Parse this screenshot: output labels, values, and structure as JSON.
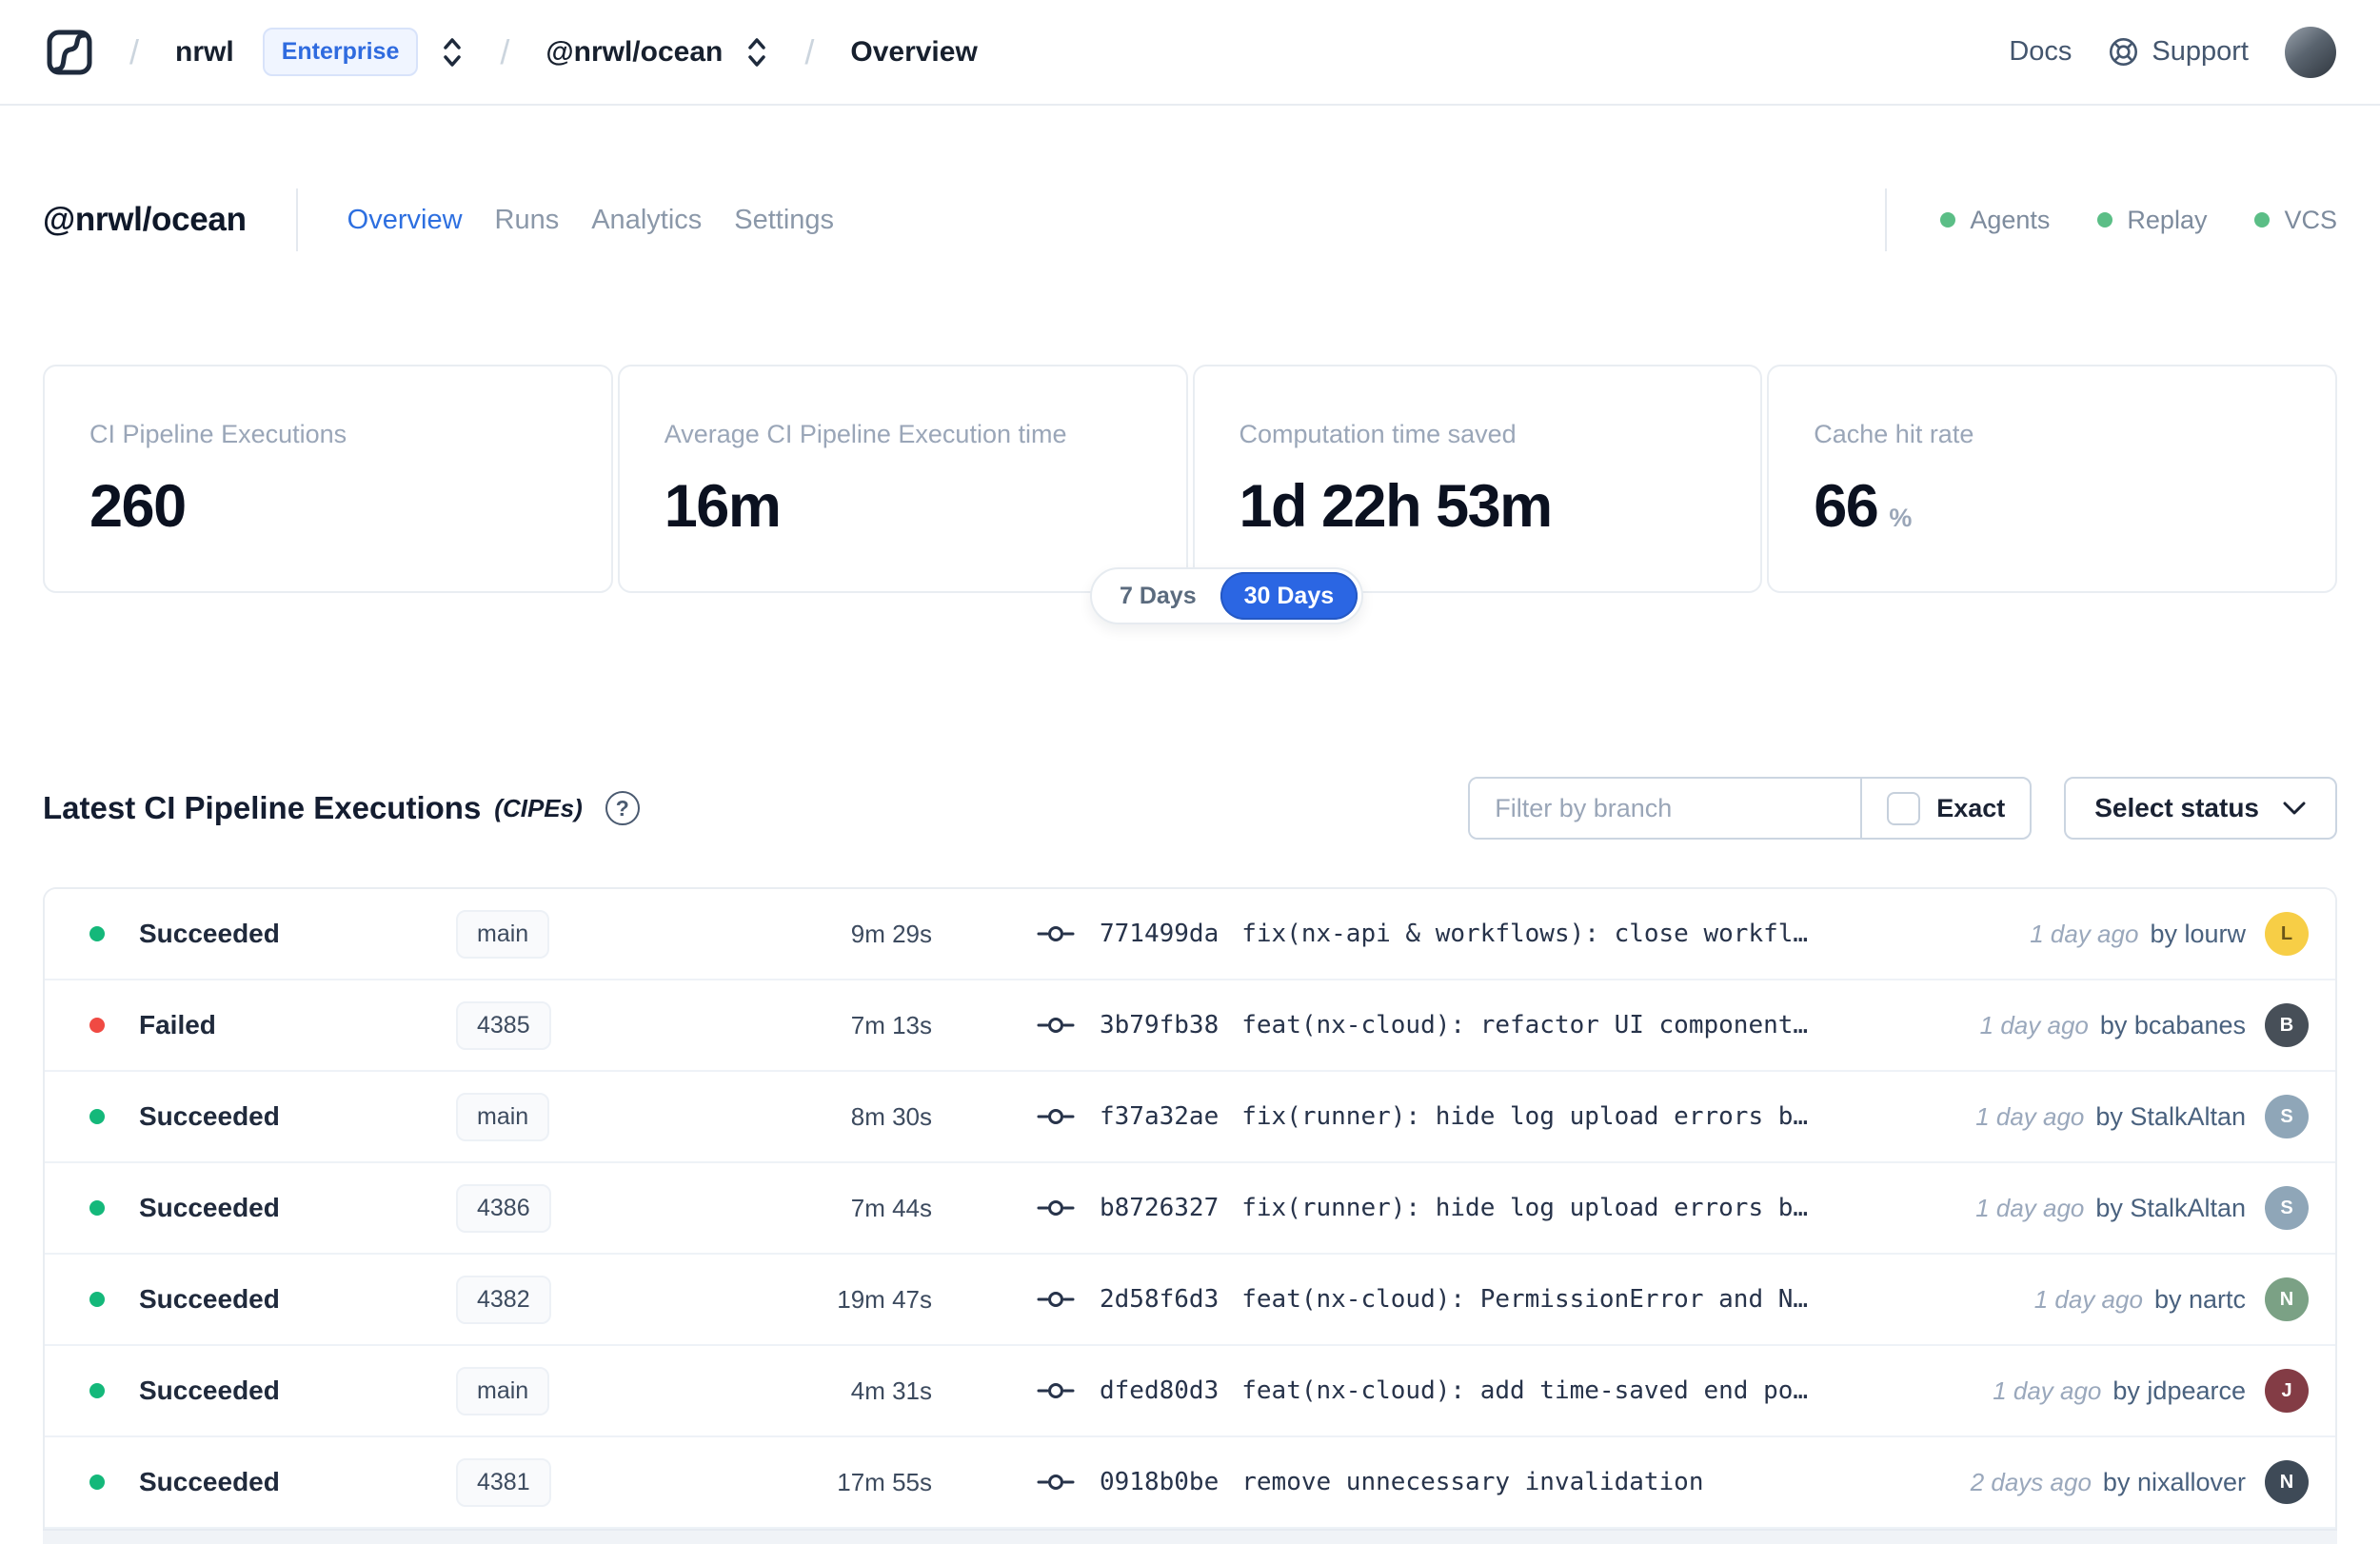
{
  "colors": {
    "accent_blue": "#2b66e3",
    "success_green": "#14b87a",
    "failed_red": "#f04a43",
    "env_dot_green": "#5bbe86"
  },
  "navbar": {
    "org": "nrwl",
    "org_badge": "Enterprise",
    "workspace": "@nrwl/ocean",
    "page": "Overview",
    "docs_label": "Docs",
    "support_label": "Support"
  },
  "header": {
    "title": "@nrwl/ocean",
    "tabs": [
      {
        "label": "Overview",
        "active": true
      },
      {
        "label": "Runs",
        "active": false
      },
      {
        "label": "Analytics",
        "active": false
      },
      {
        "label": "Settings",
        "active": false
      }
    ],
    "env_statuses": [
      "Agents",
      "Replay",
      "VCS"
    ]
  },
  "stats": [
    {
      "label": "CI Pipeline Executions",
      "value": "260"
    },
    {
      "label": "Average CI Pipeline Execution time",
      "value": "16m"
    },
    {
      "label": "Computation time saved",
      "value": "1d 22h 53m"
    },
    {
      "label": "Cache hit rate",
      "value": "66",
      "suffix": "%"
    }
  ],
  "range_toggle": {
    "options": [
      "7 Days",
      "30 Days"
    ],
    "active": "30 Days"
  },
  "cipe_section": {
    "title": "Latest CI Pipeline Executions",
    "subtitle": "(CIPEs)",
    "filter_placeholder": "Filter by branch",
    "exact_label": "Exact",
    "status_select_label": "Select status"
  },
  "table": {
    "rows": [
      {
        "status": "Succeeded",
        "status_color": "#14b87a",
        "branch": "main",
        "duration": "9m 29s",
        "commit_hash": "771499da",
        "commit_message": "fix(nx-api & workflows): close workfl…",
        "time_ago": "1 day ago",
        "author": "by lourw",
        "avatar_initial": "L",
        "avatar_color": "#f7ce46",
        "avatar_fg": "#6b5618"
      },
      {
        "status": "Failed",
        "status_color": "#f04a43",
        "branch": "4385",
        "duration": "7m 13s",
        "commit_hash": "3b79fb38",
        "commit_message": "feat(nx-cloud): refactor UI component…",
        "time_ago": "1 day ago",
        "author": "by bcabanes",
        "avatar_initial": "B",
        "avatar_color": "#474f58",
        "avatar_fg": "#ffffff"
      },
      {
        "status": "Succeeded",
        "status_color": "#14b87a",
        "branch": "main",
        "duration": "8m 30s",
        "commit_hash": "f37a32ae",
        "commit_message": "fix(runner): hide log upload errors b…",
        "time_ago": "1 day ago",
        "author": "by StalkAltan",
        "avatar_initial": "S",
        "avatar_color": "#8fa6b8",
        "avatar_fg": "#ffffff"
      },
      {
        "status": "Succeeded",
        "status_color": "#14b87a",
        "branch": "4386",
        "duration": "7m 44s",
        "commit_hash": "b8726327",
        "commit_message": "fix(runner): hide log upload errors b…",
        "time_ago": "1 day ago",
        "author": "by StalkAltan",
        "avatar_initial": "S",
        "avatar_color": "#8fa6b8",
        "avatar_fg": "#ffffff"
      },
      {
        "status": "Succeeded",
        "status_color": "#14b87a",
        "branch": "4382",
        "duration": "19m 47s",
        "commit_hash": "2d58f6d3",
        "commit_message": "feat(nx-cloud): PermissionError and N…",
        "time_ago": "1 day ago",
        "author": "by nartc",
        "avatar_initial": "N",
        "avatar_color": "#7ba185",
        "avatar_fg": "#ffffff"
      },
      {
        "status": "Succeeded",
        "status_color": "#14b87a",
        "branch": "main",
        "duration": "4m 31s",
        "commit_hash": "dfed80d3",
        "commit_message": "feat(nx-cloud): add time-saved end po…",
        "time_ago": "1 day ago",
        "author": "by jdpearce",
        "avatar_initial": "J",
        "avatar_color": "#833c45",
        "avatar_fg": "#ffffff"
      },
      {
        "status": "Succeeded",
        "status_color": "#14b87a",
        "branch": "4381",
        "duration": "17m 55s",
        "commit_hash": "0918b0be",
        "commit_message": "remove unnecessary invalidation",
        "time_ago": "2 days ago",
        "author": "by nixallover",
        "avatar_initial": "N",
        "avatar_color": "#3e4a57",
        "avatar_fg": "#ffffff"
      }
    ]
  }
}
